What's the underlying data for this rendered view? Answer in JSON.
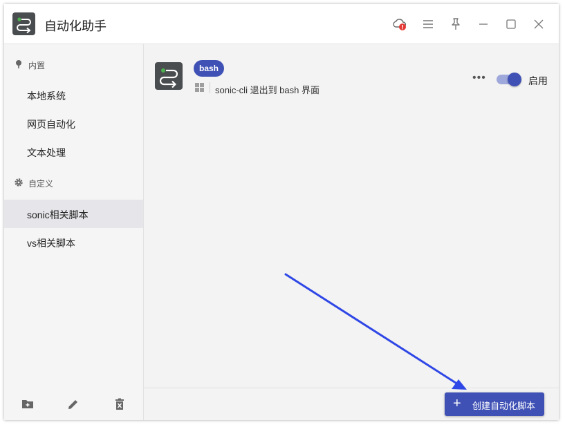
{
  "app": {
    "title": "自动化助手",
    "logo_icon": "terminal-icon"
  },
  "titlebar": {
    "icons": [
      "cloud-alert-icon",
      "menu-icon",
      "pin-icon",
      "minimize-icon",
      "maximize-icon",
      "close-icon"
    ]
  },
  "sidebar": {
    "groups": [
      {
        "label": "内置",
        "icon": "pin-icon"
      },
      {
        "label": "自定义",
        "icon": "gear-icon"
      }
    ],
    "items": [
      {
        "label": "本地系统"
      },
      {
        "label": "网页自动化"
      },
      {
        "label": "文本处理"
      },
      {
        "label": "sonic相关脚本",
        "active": true
      },
      {
        "label": "vs相关脚本"
      }
    ],
    "tools": [
      "new-folder-icon",
      "edit-icon",
      "delete-icon"
    ]
  },
  "script": {
    "tag": "bash",
    "platform_icon": "windows-icon",
    "description": "sonic-cli 退出到 bash 界面",
    "more_label": "•••",
    "enabled": true,
    "enabled_label": "启用"
  },
  "footer": {
    "create_button_label": "创建自动化脚本"
  },
  "colors": {
    "accent": "#3f51b5",
    "toggle_track": "#9fa8da",
    "alert": "#e53935",
    "annotation_arrow": "#2f47e6"
  }
}
